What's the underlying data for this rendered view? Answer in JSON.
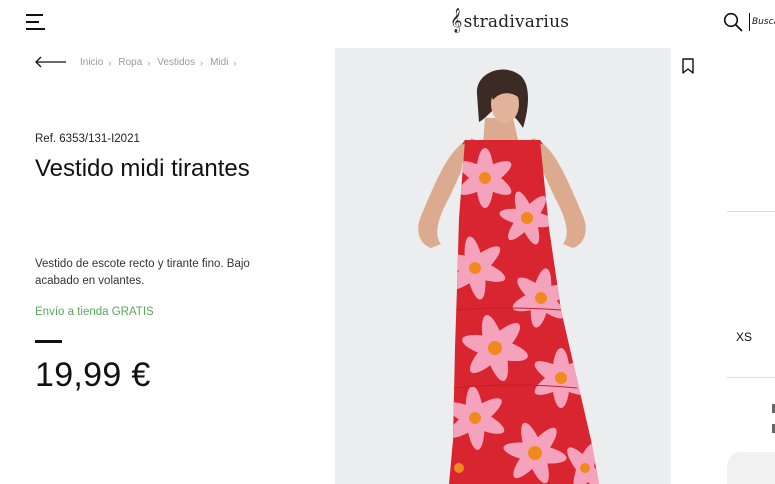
{
  "header": {
    "logo_text": "stradivarius",
    "search_placeholder": "Busca"
  },
  "breadcrumb": [
    "Inicio",
    "Ropa",
    "Vestidos",
    "Midi"
  ],
  "product": {
    "reference": "Ref. 6353/131-I2021",
    "title": "Vestido midi tirantes",
    "description": "Vestido de escote recto y tirante fino. Bajo acabado en volantes.",
    "shipping": "Envío a tienda GRATIS",
    "price": "19,99 €"
  },
  "sizes": [
    "XS"
  ],
  "icons": {
    "menu": "hamburger-menu-icon",
    "search": "search-icon",
    "back": "back-arrow-icon",
    "breadcrumb_separator": "chevron-right-icon",
    "wishlist": "bookmark-icon"
  },
  "colors": {
    "shipping_green": "#5aa85a",
    "dress_pink": "#f5a3bd",
    "dress_red": "#d9252f",
    "flower_center": "#f08a1f"
  }
}
